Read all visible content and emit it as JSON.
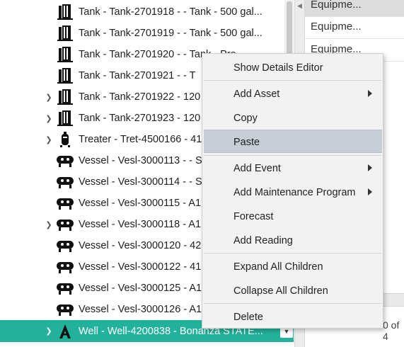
{
  "tree": {
    "rows": [
      {
        "label": "Tank - Tank-2701918 -  - Tank - 500 gal...",
        "icon": "tank-icon",
        "expandable": false
      },
      {
        "label": "Tank - Tank-2701919 -  - Tank - 500 gal...",
        "icon": "tank-icon",
        "expandable": false
      },
      {
        "label": "Tank - Tank-2701920 -  - Tank - Pro...",
        "icon": "tank-icon",
        "expandable": false
      },
      {
        "label": "Tank - Tank-2701921 -  - T",
        "icon": "tank-icon",
        "expandable": false
      },
      {
        "label": "Tank - Tank-2701922 - 120",
        "icon": "tank-icon",
        "expandable": true
      },
      {
        "label": "Tank - Tank-2701923 - 120",
        "icon": "tank-icon",
        "expandable": true
      },
      {
        "label": "Treater - Tret-4500166 - 41",
        "icon": "treater-icon",
        "expandable": true
      },
      {
        "label": "Vessel - Vesl-3000113 -  - S",
        "icon": "vessel-icon",
        "expandable": false
      },
      {
        "label": "Vessel - Vesl-3000114 -  - S",
        "icon": "vessel-icon",
        "expandable": false
      },
      {
        "label": "Vessel - Vesl-3000115 - A1",
        "icon": "vessel-icon",
        "expandable": false
      },
      {
        "label": "Vessel - Vesl-3000118 - A1",
        "icon": "vessel-icon",
        "expandable": true
      },
      {
        "label": "Vessel - Vesl-3000120 - 42",
        "icon": "vessel-icon",
        "expandable": false
      },
      {
        "label": "Vessel - Vesl-3000122 - 41",
        "icon": "vessel-icon",
        "expandable": false
      },
      {
        "label": "Vessel - Vesl-3000125 - A1",
        "icon": "vessel-icon",
        "expandable": false
      },
      {
        "label": "Vessel - Vesl-3000126 - A1",
        "icon": "vessel-icon",
        "expandable": false
      },
      {
        "label": "Well - Well-4200838 - Bonanza STATE...",
        "icon": "well-icon",
        "expandable": true,
        "selected": true
      }
    ]
  },
  "right_panel": {
    "cells": [
      "Equipme...",
      "Equipme...",
      "Equipme..."
    ],
    "pager_text": "0 of 4"
  },
  "context_menu": {
    "items": [
      {
        "label": "Show Details Editor",
        "submenu": false
      },
      {
        "label": "Add Asset",
        "submenu": true
      },
      {
        "label": "Copy",
        "submenu": false
      },
      {
        "label": "Paste",
        "submenu": false,
        "highlighted": true
      },
      {
        "label": "Add Event",
        "submenu": true
      },
      {
        "label": "Add Maintenance Program",
        "submenu": true
      },
      {
        "label": "Forecast",
        "submenu": false
      },
      {
        "label": "Add Reading",
        "submenu": false
      },
      {
        "label": "Expand All Children",
        "submenu": false
      },
      {
        "label": "Collapse All Children",
        "submenu": false
      },
      {
        "label": "Delete",
        "submenu": false
      }
    ]
  },
  "colors": {
    "selected_row": "#22b29b",
    "menu_highlight": "#c7ced6",
    "menu_background": "#f2f2f2"
  }
}
